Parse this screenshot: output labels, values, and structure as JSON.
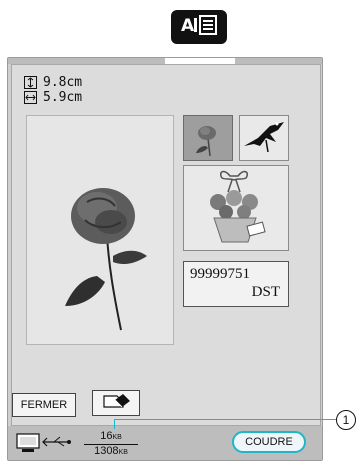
{
  "top_tab": {
    "icon": "embroidery-edit-icon"
  },
  "dimensions": {
    "height": "9.8cm",
    "width": "5.9cm",
    "height_icon": "vertical-size-icon",
    "width_icon": "horizontal-size-icon"
  },
  "preview": {
    "icon": "rose-preview-icon"
  },
  "thumbnails": [
    {
      "icon": "rose-thumbnail-icon",
      "selected": true
    },
    {
      "icon": "bird-thumbnail-icon",
      "selected": false
    },
    {
      "icon": "flower-bouquet-thumbnail-icon",
      "selected": false
    }
  ],
  "file_info": {
    "number": "99999751",
    "format": "DST"
  },
  "buttons": {
    "close_label": "FERMER",
    "delete_icon": "eraser-icon",
    "sew_label": "COUDRE"
  },
  "status_bar": {
    "device_icon": "computer-usb-icon",
    "used": "16",
    "used_unit": "KB",
    "total": "1308",
    "total_unit": "KB"
  },
  "callout": {
    "number": "1"
  },
  "colors": {
    "accent": "#1fb6c7",
    "panel": "#dcdcdc",
    "status_bar": "#bdbdbd"
  }
}
